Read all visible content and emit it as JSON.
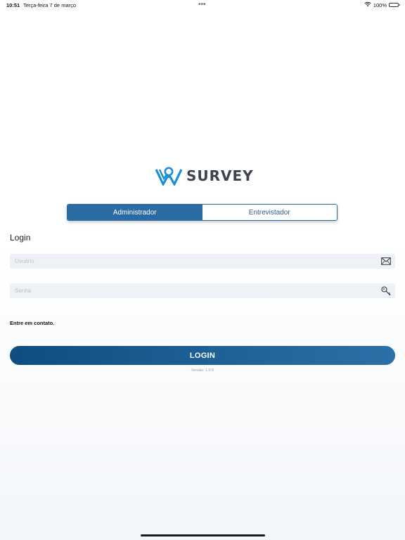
{
  "status_bar": {
    "time": "10:51",
    "date": "Terça-feira 7 de março",
    "dots": "•••",
    "battery": "100%",
    "icons": [
      "wifi-icon",
      "battery-icon"
    ]
  },
  "logo": {
    "text": "SURVEY",
    "brand_color": "#1e8fd6",
    "text_color": "#3c4452"
  },
  "segmented": {
    "options": [
      {
        "label": "Administrador",
        "selected": true
      },
      {
        "label": "Entrevistador",
        "selected": false
      }
    ],
    "active_color": "#2a6ba3"
  },
  "form": {
    "heading": "Login",
    "username": {
      "value": "",
      "placeholder": "Usuário",
      "icon": "envelope-icon"
    },
    "password": {
      "value": "",
      "placeholder": "Senha",
      "icon": "key-icon"
    },
    "contact_label": "Entre em contato.",
    "login_label": "LOGIN",
    "version": "Versão: 1.0.0"
  }
}
